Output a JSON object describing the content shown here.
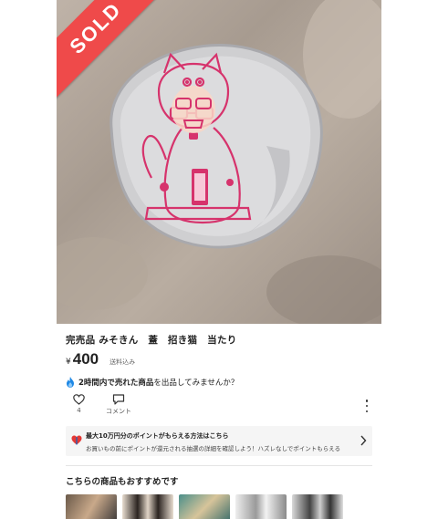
{
  "sold_badge": "SOLD",
  "product": {
    "title": "完売品 みそきん　蓋　招き猫　当たり",
    "currency": "¥",
    "price": "400",
    "shipping": "送料込み"
  },
  "promo": {
    "prefix": "2時間内で売れた商品",
    "suffix": "を出品してみませんか？"
  },
  "actions": {
    "likes_count": "4",
    "comment_label": "コメント"
  },
  "points_banner": {
    "title": "最大10万円分のポイントがもらえる方法はこちら",
    "description": "お買いもの前にポイントが還元される抽選の詳細を確認しよう！ハズレなしでポイントもらえる"
  },
  "recommend": {
    "heading": "こちらの商品もおすすめです"
  },
  "colors": {
    "sold_red": "#ef4a4a",
    "lid_print": "#d6336c",
    "flame_blue": "#1e88e5"
  }
}
